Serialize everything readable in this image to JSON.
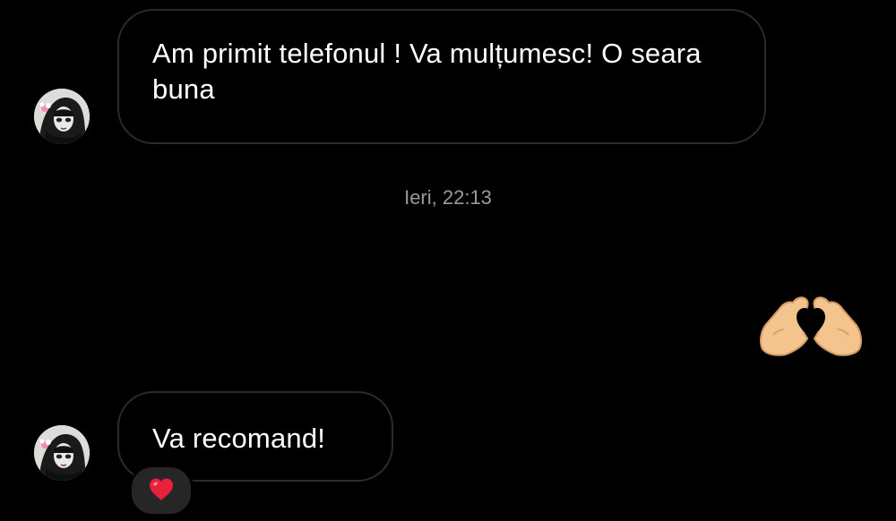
{
  "conversation": {
    "messages": [
      {
        "text": "Am primit telefonul ! Va mulțumesc! O seara buna"
      },
      {
        "text": "Va recomand!",
        "reaction": "red-heart-icon"
      }
    ],
    "timestamp": "Ieri, 22:13",
    "sent_sticker": "heart-hands-icon"
  },
  "colors": {
    "background": "#000000",
    "bubble_border": "#2b2b2b",
    "text": "#ffffff",
    "timestamp": "#9a9a9a",
    "reaction_pill": "#262626",
    "heart": "#e8203a",
    "skin": "#f4c48e"
  }
}
